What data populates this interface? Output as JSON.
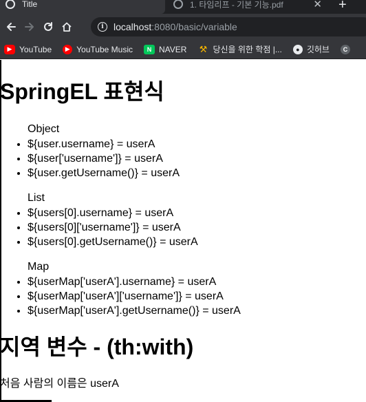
{
  "browser": {
    "tabs": [
      {
        "title": "Title",
        "active": true
      },
      {
        "title": "1. 타임리프 - 기본 기능.pdf",
        "active": false
      }
    ],
    "new_tab_label": "+",
    "url": {
      "host": "localhost",
      "path": ":8080/basic/variable"
    },
    "bookmarks": [
      {
        "label": "YouTube",
        "icon": "youtube-icon"
      },
      {
        "label": "YouTube Music",
        "icon": "youtube-music-icon"
      },
      {
        "label": "NAVER",
        "icon": "naver-icon"
      },
      {
        "label": "당신을 위한 학점 |...",
        "icon": "hammer-icon"
      },
      {
        "label": "깃허브",
        "icon": "github-icon"
      }
    ]
  },
  "page": {
    "heading_spring": "SpringEL 표현식",
    "object_label": "Object",
    "object_items": [
      "${user.username} = userA",
      "${user['username']} = userA",
      "${user.getUsername()} = userA"
    ],
    "list_label": "List",
    "list_items": [
      "${users[0].username} = userA",
      "${users[0]['username']} = userA",
      "${users[0].getUsername()} = userA"
    ],
    "map_label": "Map",
    "map_items": [
      "${userMap['userA'].username} = userA",
      "${userMap['userA']['username']} = userA",
      "${userMap['userA'].getUsername()} = userA"
    ],
    "heading_local": "지역 변수 - (th:with)",
    "local_text": "처음 사람의 이름은 userA"
  },
  "colors": {
    "tabstrip": "#202124",
    "toolbar": "#35363a",
    "text_light": "#e8eaed",
    "youtube_red": "#ff0000",
    "naver_green": "#03c75a"
  }
}
